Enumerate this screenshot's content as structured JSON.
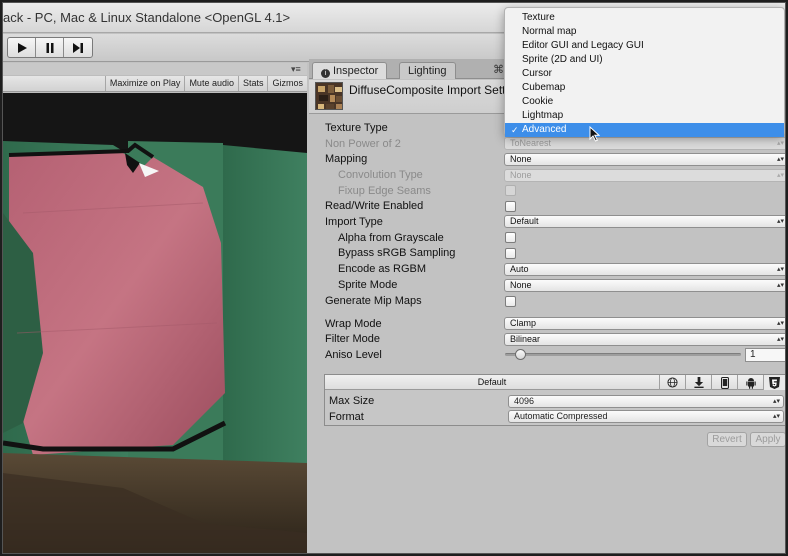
{
  "window": {
    "title": "ack - PC, Mac & Linux Standalone <OpenGL 4.1>"
  },
  "game_toolbar": {
    "maximize_on_play": "Maximize on Play",
    "mute_audio": "Mute audio",
    "stats": "Stats",
    "gizmos": "Gizmos"
  },
  "inspector": {
    "tabs": {
      "inspector": "Inspector",
      "lighting": "Lighting"
    },
    "header_title": "DiffuseComposite Import Settin",
    "properties": {
      "texture_type": "Texture Type",
      "non_power_of_2": "Non Power of 2",
      "non_power_of_2_value": "ToNearest",
      "mapping": "Mapping",
      "mapping_value": "None",
      "convolution_type": "Convolution Type",
      "convolution_type_value": "None",
      "fixup_edge_seams": "Fixup Edge Seams",
      "read_write_enabled": "Read/Write Enabled",
      "import_type": "Import Type",
      "import_type_value": "Default",
      "alpha_from_grayscale": "Alpha from Grayscale",
      "bypass_srgb": "Bypass sRGB Sampling",
      "encode_as_rgbm": "Encode as RGBM",
      "encode_as_rgbm_value": "Auto",
      "sprite_mode": "Sprite Mode",
      "sprite_mode_value": "None",
      "generate_mip_maps": "Generate Mip Maps",
      "wrap_mode": "Wrap Mode",
      "wrap_mode_value": "Clamp",
      "filter_mode": "Filter Mode",
      "filter_mode_value": "Bilinear",
      "aniso_level": "Aniso Level",
      "aniso_level_value": "1"
    },
    "platform": {
      "default_label": "Default",
      "max_size": "Max Size",
      "max_size_value": "4096",
      "format": "Format",
      "format_value": "Automatic Compressed"
    },
    "buttons": {
      "revert": "Revert",
      "apply": "Apply"
    }
  },
  "texture_type_menu": {
    "items": [
      "Texture",
      "Normal map",
      "Editor GUI and Legacy GUI",
      "Sprite (2D and UI)",
      "Cursor",
      "Cubemap",
      "Cookie",
      "Lightmap",
      "Advanced"
    ],
    "selected": "Advanced",
    "check_mark": "✓"
  },
  "colors": {
    "menu_highlight": "#3d8ee9",
    "panel_bg": "#c2c2c2"
  },
  "icons": {
    "play": "play-icon",
    "pause": "pause-icon",
    "step": "step-icon",
    "platforms": [
      "globe-icon",
      "download-icon",
      "mobile-icon",
      "android-icon",
      "html5-icon"
    ]
  }
}
